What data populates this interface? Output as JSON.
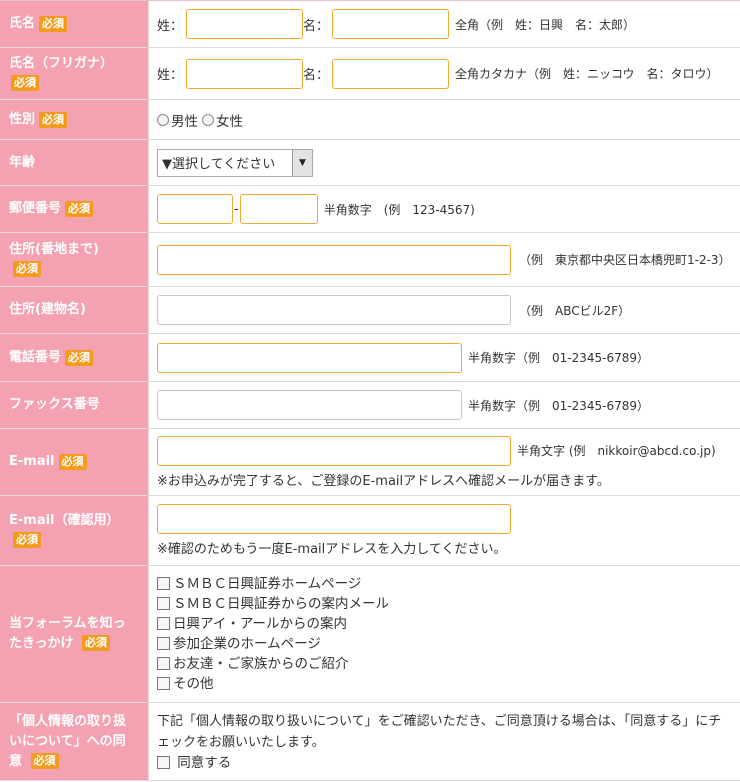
{
  "required_badge": "必須",
  "rows": {
    "name": {
      "label": "氏名",
      "sei": "姓：",
      "mei": "名：",
      "hint": "全角（例　姓：日興　名：太郎）"
    },
    "furigana": {
      "label": "氏名（フリガナ）",
      "sei": "姓：",
      "mei": "名：",
      "hint": "全角カタカナ（例　姓：ニッコウ　名：タロウ）"
    },
    "gender": {
      "label": "性別",
      "options": [
        "男性",
        "女性"
      ]
    },
    "age": {
      "label": "年齢",
      "select_value": "▼選択してください"
    },
    "zip": {
      "label": "郵便番号",
      "sep": "-",
      "hint": "半角数字　(例　123-4567)"
    },
    "address": {
      "label": "住所(番地まで)",
      "hint": "（例　東京都中央区日本橋兜町1-2-3）"
    },
    "building": {
      "label": "住所(建物名)",
      "hint": "（例　ABCビル2F）"
    },
    "phone": {
      "label": "電話番号",
      "hint": "半角数字（例　01-2345-6789）"
    },
    "fax": {
      "label": "ファックス番号",
      "hint": "半角数字（例　01-2345-6789）"
    },
    "email": {
      "label": "E-mail",
      "hint": "半角文字 (例　nikkoir@abcd.co.jp)",
      "note": "※お申込みが完了すると、ご登録のE-mailアドレスへ確認メールが届きます。"
    },
    "email_confirm": {
      "label": "E-mail（確認用）",
      "note": "※確認のためもう一度E-mailアドレスを入力してください。"
    },
    "source": {
      "label": "当フォーラムを知ったきっかけ",
      "options": [
        "ＳＭＢＣ日興証券ホームページ",
        "ＳＭＢＣ日興証券からの案内メール",
        "日興アイ・アールからの案内",
        "参加企業のホームページ",
        "お友達・ご家族からのご紹介",
        "その他"
      ]
    },
    "privacy": {
      "label": "「個人情報の取り扱いについて」への同意",
      "text": "下記「個人情報の取り扱いについて」をご確認いただき、ご同意頂ける場合は、「同意する」にチェックをお願いいたします。",
      "agree": "同意する"
    }
  }
}
